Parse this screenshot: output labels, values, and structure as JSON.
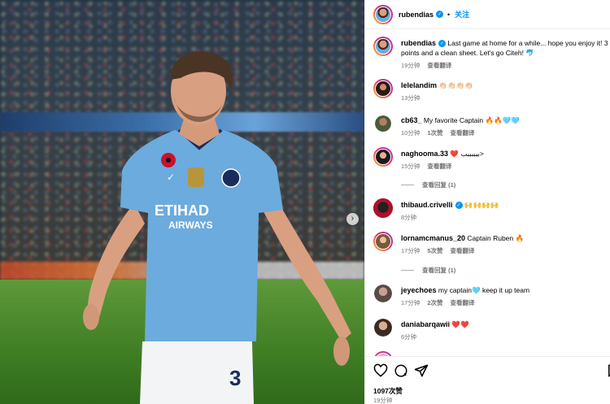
{
  "header": {
    "username": "rubendias",
    "separator": "•",
    "follow_label": "关注"
  },
  "carousel": {
    "next_glyph": "›"
  },
  "caption": {
    "username": "rubendias",
    "text": "Last game at home for a while... hope you enjoy it! 3 points and a clean sheet. Let's go Citeh! 🐬",
    "time": "19分钟",
    "translate": "查看翻译"
  },
  "comments": [
    {
      "username": "lelelandim",
      "text": "👏🏻👏🏻👏🏻👏🏻",
      "time": "13分钟",
      "likes": "",
      "translate": "",
      "verified": false
    },
    {
      "username": "cb63_",
      "text": "My favorite Captain 🔥🔥🩵🩵",
      "time": "10分钟",
      "likes": "1次赞",
      "translate": "查看翻译",
      "verified": false
    },
    {
      "username": "naghooma.33",
      "text": "❤️ ببببببب>",
      "time": "15分钟",
      "likes": "",
      "translate": "查看翻译",
      "verified": false,
      "replies": "查看回复 (1)"
    },
    {
      "username": "thibaud.crivelli",
      "text": "🙌🙌🙌🙌",
      "time": "8分钟",
      "likes": "",
      "translate": "",
      "verified": true
    },
    {
      "username": "lornamcmanus_20",
      "text": "Captain Ruben 🔥",
      "time": "17分钟",
      "likes": "5次赞",
      "translate": "查看翻译",
      "verified": false,
      "replies": "查看回复 (1)"
    },
    {
      "username": "jeyechoes",
      "text": "my captain🩵 keep it up team",
      "time": "17分钟",
      "likes": "2次赞",
      "translate": "查看翻译",
      "verified": false
    },
    {
      "username": "daniabarqawii",
      "text": "❤️❤️",
      "time": "6分钟",
      "likes": "",
      "translate": "",
      "verified": false
    }
  ],
  "footer": {
    "likes": "1097次赞",
    "time": "19分钟"
  },
  "jersey": {
    "sponsor_line1": "ETIHAD",
    "sponsor_line2": "AIRWAYS",
    "number": "3"
  },
  "colors": {
    "accent": "#0095f6",
    "muted": "#737373",
    "sky_blue": "#6cabdd",
    "heart_red": "#ed4956"
  }
}
